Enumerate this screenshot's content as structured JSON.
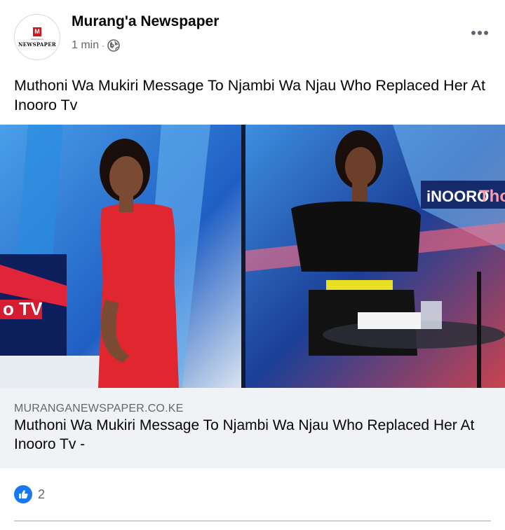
{
  "post": {
    "author": "Murang'a Newspaper",
    "time": "1 min",
    "separator": "·",
    "privacy_icon": "globe-icon",
    "text": "Muthoni Wa Mukiri Message To Njambi Wa Njau Who Replaced Her At Inooro Tv",
    "avatar": {
      "mark": "M",
      "small_text": "MURANG'A",
      "logo_text": "NEWSPAPER"
    }
  },
  "image": {
    "left_screen_text": "o TV",
    "right_banner_text_1": "iNOORO",
    "right_banner_text_2": "Tho"
  },
  "link": {
    "domain": "MURANGANEWSPAPER.CO.KE",
    "title": "Muthoni Wa Mukiri Message To Njambi Wa Njau Who Replaced Her At Inooro Tv -"
  },
  "reactions": {
    "icon": "thumbs-up-icon",
    "count": "2"
  },
  "colors": {
    "facebook_blue": "#1877f2",
    "preview_bg": "#f0f2f5",
    "meta_gray": "#65676b"
  }
}
